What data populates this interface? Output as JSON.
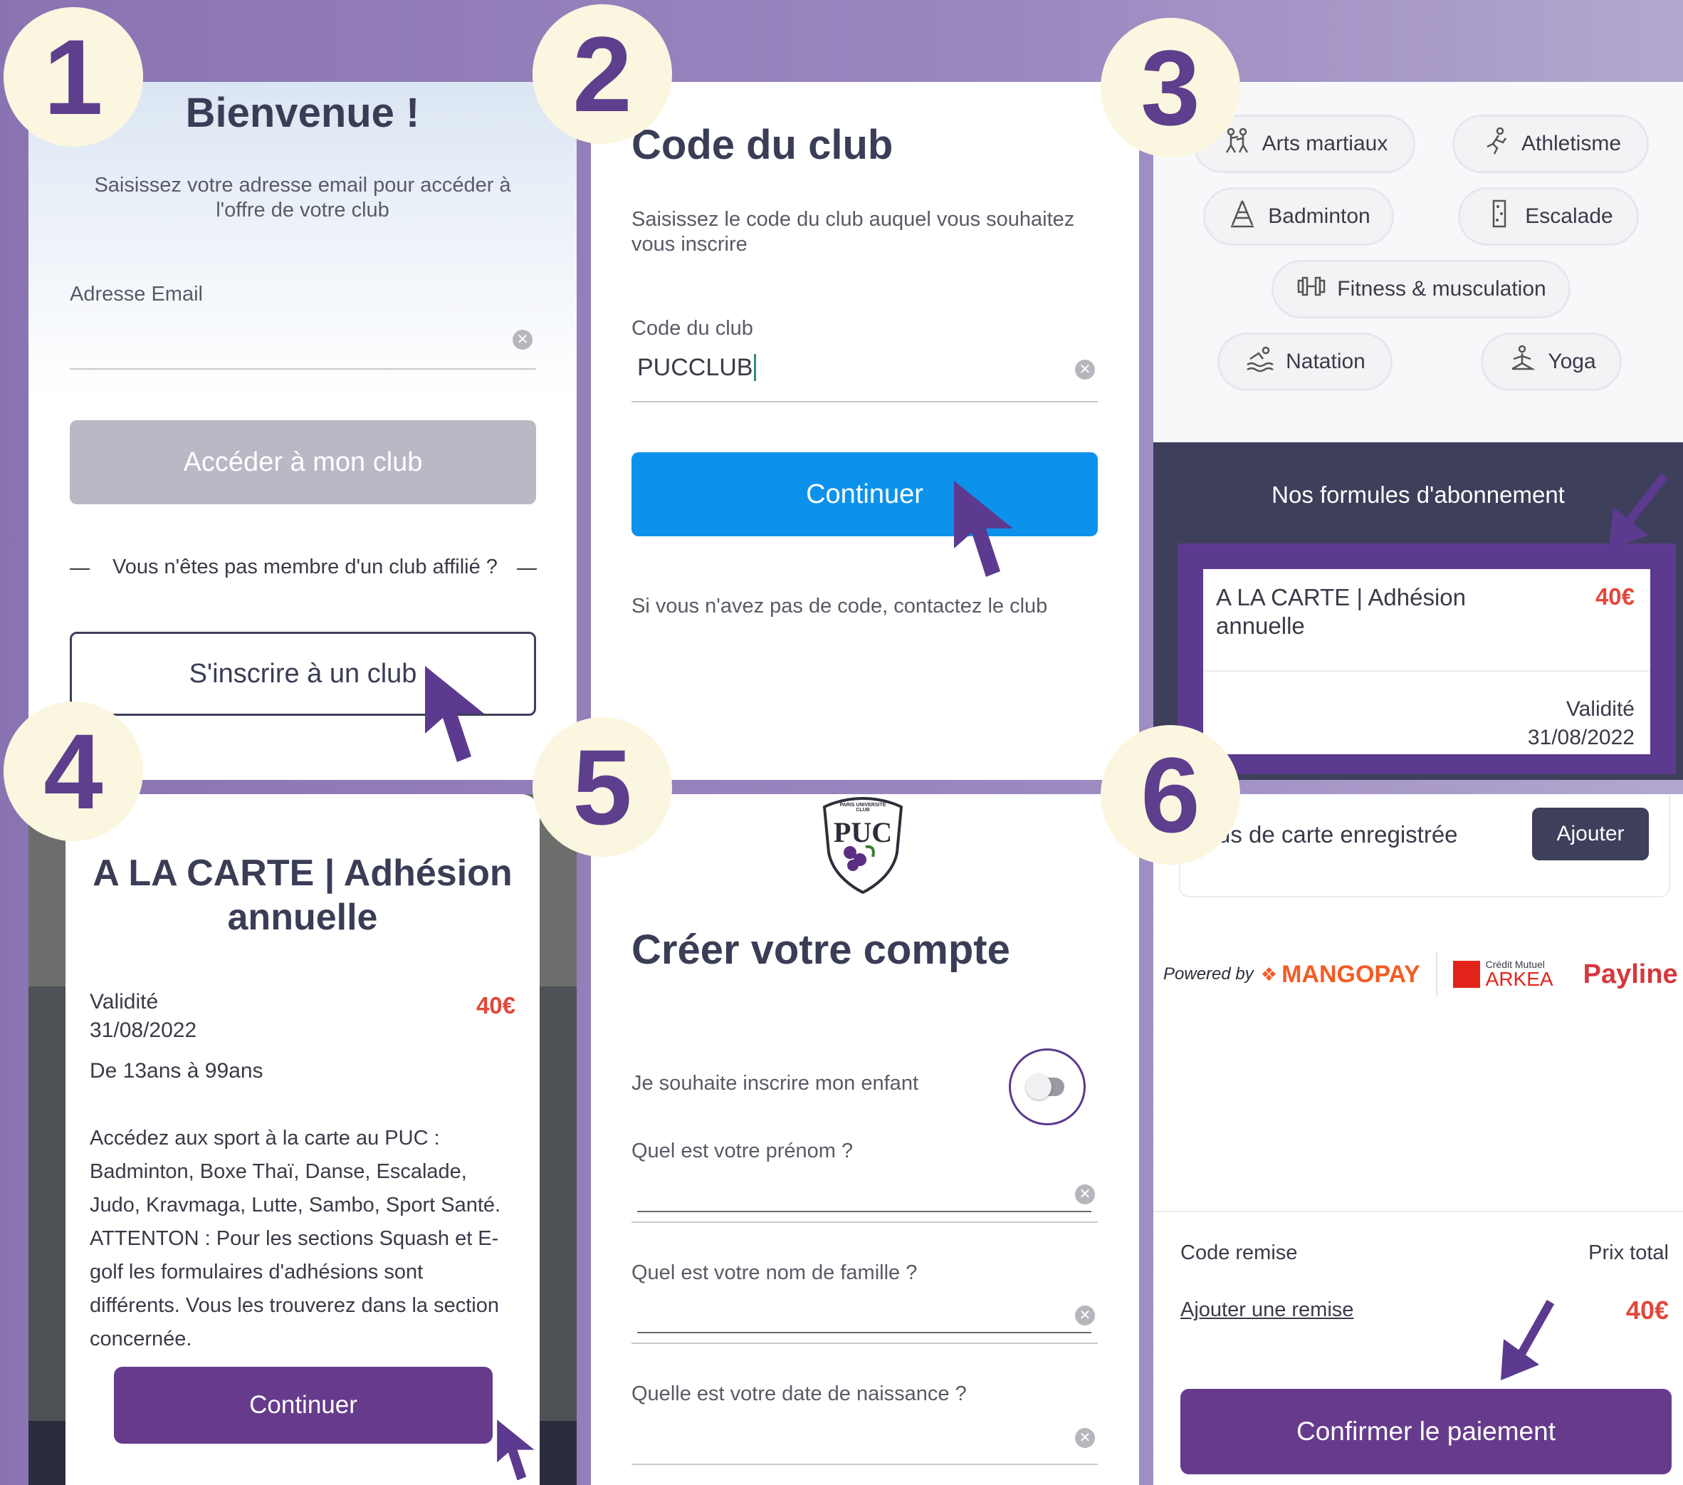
{
  "steps": [
    "1",
    "2",
    "3",
    "4",
    "5",
    "6"
  ],
  "panel1": {
    "title": "Bienvenue !",
    "subtitle": "Saisissez votre adresse email pour accéder à l'offre de votre club",
    "email_label": "Adresse Email",
    "email_value": "",
    "access_button": "Accéder à mon club",
    "not_member": "Vous n'êtes pas membre d'un club affilié ?",
    "register_button": "S'inscrire à un club"
  },
  "panel2": {
    "title": "Code du club",
    "subtitle": "Saisissez le code du club auquel vous souhaitez vous inscrire",
    "code_label": "Code du club",
    "code_value": "PUCCLUB",
    "continue_button": "Continuer",
    "no_code": "Si vous n'avez pas de code, contactez le club"
  },
  "panel3": {
    "sports": [
      {
        "label": "Arts martiaux",
        "icon": "martial-arts-icon"
      },
      {
        "label": "Athletisme",
        "icon": "runner-icon"
      },
      {
        "label": "Badminton",
        "icon": "badminton-icon"
      },
      {
        "label": "Escalade",
        "icon": "climbing-icon"
      },
      {
        "label": "Fitness & musculation",
        "icon": "dumbbell-icon"
      },
      {
        "label": "Natation",
        "icon": "swimming-icon"
      },
      {
        "label": "Yoga",
        "icon": "yoga-icon"
      }
    ],
    "formulas_title": "Nos formules d'abonnement",
    "card_name": "A LA CARTE | Adhésion annuelle",
    "card_price": "40€",
    "validity_label": "Validité",
    "validity_date": "31/08/2022",
    "highlight_color": "#5c3a8f"
  },
  "panel4": {
    "title": "A LA CARTE | Adhésion annuelle",
    "validity_label": "Validité",
    "validity_date": "31/08/2022",
    "price": "40€",
    "age_range": "De 13ans à 99ans",
    "description": "Accédez aux sport à la carte au PUC : Badminton, Boxe Thaï, Danse, Escalade, Judo, Kravmaga, Lutte, Sambo, Sport Santé. ATTENTON : Pour les sections Squash et E-golf les formulaires d'adhésions sont différents. Vous les trouverez dans la section concernée.",
    "continue_button": "Continuer"
  },
  "panel5": {
    "logo_text": "PUC",
    "logo_ring_text": "PARIS UNIVERSITÉ CLUB",
    "title": "Créer votre compte",
    "child_toggle_label": "Je souhaite inscrire mon enfant",
    "child_toggle_on": false,
    "firstname_label": "Quel est votre prénom ?",
    "lastname_label": "Quel est votre nom de famille ?",
    "birthdate_label": "Quelle est votre date de naissance ?"
  },
  "panel6": {
    "no_card_text": "us de carte enregistrée",
    "add_button": "Ajouter",
    "powered_by": "Powered by",
    "mangopay": "MANGOPAY",
    "arkea_small": "Crédit Mutuel",
    "arkea": "ARKEA",
    "payline": "Payline",
    "discount_label": "Code remise",
    "total_label": "Prix total",
    "add_discount_link": "Ajouter une remise",
    "total_price": "40€",
    "confirm_button": "Confirmer le paiement"
  },
  "colors": {
    "accent_purple": "#663b8c",
    "primary_blue": "#0d92eb",
    "price_red": "#e2483c",
    "dark_navy": "#3d3f5b"
  }
}
